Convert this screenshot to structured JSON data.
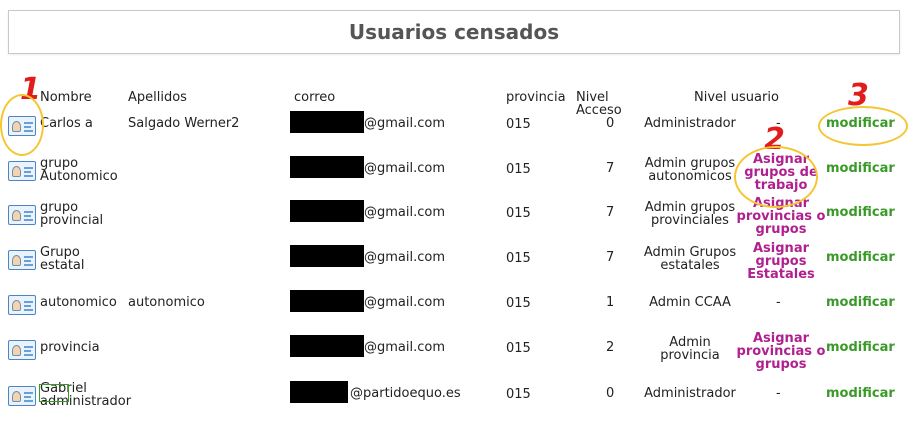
{
  "title": "Usuarios censados",
  "headers": {
    "nombre": "Nombre",
    "apellidos": "Apellidos",
    "correo": "correo",
    "provincia": "provincia",
    "nivel_acceso_1": "Nivel",
    "nivel_acceso_2": "Acceso",
    "nivel_usuario": "Nivel usuario"
  },
  "annotations": [
    "1",
    "2",
    "3"
  ],
  "rows": [
    {
      "nombre": [
        "Carlos a"
      ],
      "apellidos": "Salgado Werner2",
      "email": "@gmail.com",
      "provincia": "015",
      "nivel": "0",
      "rol": [
        "Administrador"
      ],
      "accion": "-",
      "modificar": "modificar"
    },
    {
      "nombre": [
        "grupo",
        "Autonomico"
      ],
      "apellidos": "",
      "email": "@gmail.com",
      "provincia": "015",
      "nivel": "7",
      "rol": [
        "Admin grupos",
        "autonomicos"
      ],
      "accion": [
        "Asignar",
        "grupos de",
        "trabajo"
      ],
      "modificar": "modificar"
    },
    {
      "nombre": [
        "grupo",
        "provincial"
      ],
      "apellidos": "",
      "email": "@gmail.com",
      "provincia": "015",
      "nivel": "7",
      "rol": [
        "Admin grupos",
        "provinciales"
      ],
      "accion": [
        "Asignar",
        "provincias o",
        "grupos"
      ],
      "modificar": "modificar"
    },
    {
      "nombre": [
        "Grupo",
        "estatal"
      ],
      "apellidos": "",
      "email": "@gmail.com",
      "provincia": "015",
      "nivel": "7",
      "rol": [
        "Admin Grupos",
        "estatales"
      ],
      "accion": [
        "Asignar",
        "grupos",
        "Estatales"
      ],
      "modificar": "modificar"
    },
    {
      "nombre": [
        "autonomico"
      ],
      "apellidos": "autonomico",
      "email": "@gmail.com",
      "provincia": "015",
      "nivel": "1",
      "rol": [
        "Admin CCAA"
      ],
      "accion": "-",
      "modificar": "modificar"
    },
    {
      "nombre": [
        "provincia"
      ],
      "apellidos": "",
      "email": "@gmail.com",
      "provincia": "015",
      "nivel": "2",
      "rol": [
        "Admin",
        "provincia"
      ],
      "accion": [
        "Asignar",
        "provincias o",
        "grupos"
      ],
      "modificar": "modificar"
    },
    {
      "nombre": [
        "Gabriel",
        "administrador"
      ],
      "apellidos": "",
      "email": "@partidoequo.es",
      "provincia": "015",
      "nivel": "0",
      "rol": [
        "Administrador"
      ],
      "accion": "-",
      "modificar": "modificar"
    }
  ]
}
